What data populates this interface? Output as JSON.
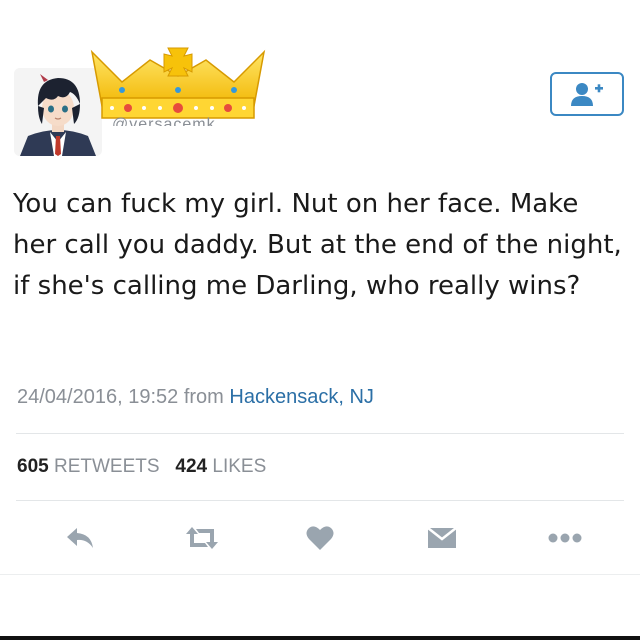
{
  "profile": {
    "handle": "@versacemk",
    "avatar_icon": "anime-avatar-icon",
    "crown_icon": "crown-icon"
  },
  "follow_button": {
    "icon": "add-user-icon"
  },
  "tweet": {
    "text": "You can fuck my girl. Nut on her face. Make her call you daddy. But at the end of the night, if she's calling me Darling, who really wins?",
    "datetime": "24/04/2016, 19:52",
    "from_label": "from",
    "location": "Hackensack, NJ"
  },
  "stats": {
    "retweets_count": "605",
    "retweets_label": "RETWEETS",
    "likes_count": "424",
    "likes_label": "LIKES"
  },
  "actions": {
    "reply_icon": "reply-icon",
    "retweet_icon": "retweet-icon",
    "like_icon": "heart-icon",
    "dm_icon": "envelope-icon",
    "more_icon": "more-icon"
  },
  "colors": {
    "accent": "#3b88c3",
    "link": "#2b6fa6",
    "muted": "#8a8f96",
    "icon": "#9aa5af"
  }
}
